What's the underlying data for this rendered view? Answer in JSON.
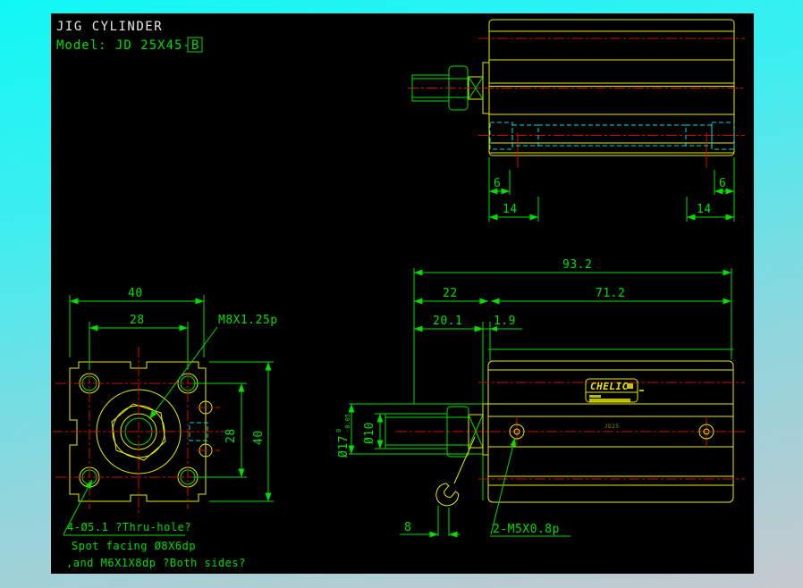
{
  "colors": {
    "line_yellow": "#e8e800",
    "dim_green": "#00dd00",
    "center_red": "#cc1100",
    "hidden_cyan": "#00dcdc",
    "title_white": "#e8e8e8",
    "canvas_black": "#000000"
  },
  "header": {
    "title": "JIG CYLINDER",
    "model_prefix": "Model: JD 25X45-",
    "model_rev": "B"
  },
  "side_view": {
    "dim_left_inner": "6",
    "dim_left_outer": "14",
    "dim_right_inner": "6",
    "dim_right_outer": "14"
  },
  "plan_view": {
    "dim_overall": "93.2",
    "dim_head": "22",
    "dim_body": "71.2",
    "dim_head_minor": "20.1",
    "dim_gap": "1.9",
    "rod_boss_dia": "Ø17",
    "rod_boss_tol_upper": "0",
    "rod_boss_tol_lower": "-0.05",
    "rod_dia": "Ø10",
    "wrench_flats": "8",
    "port_label": "2-M5X0.8p",
    "logo_text": "CHELIC",
    "body_marking": "JD25"
  },
  "front_view": {
    "dim_width_overall": "40",
    "dim_bolt_spacing_h": "28",
    "dim_bolt_spacing_v": "28",
    "dim_height_overall": "40",
    "thread_label": "M8X1.25p",
    "hole_note_1": "4-Ø5.1 ?Thru-hole?",
    "hole_note_2": "Spot facing Ø8X6dp",
    "hole_note_3": ",and M6X1X8dp ?Both sides?"
  }
}
